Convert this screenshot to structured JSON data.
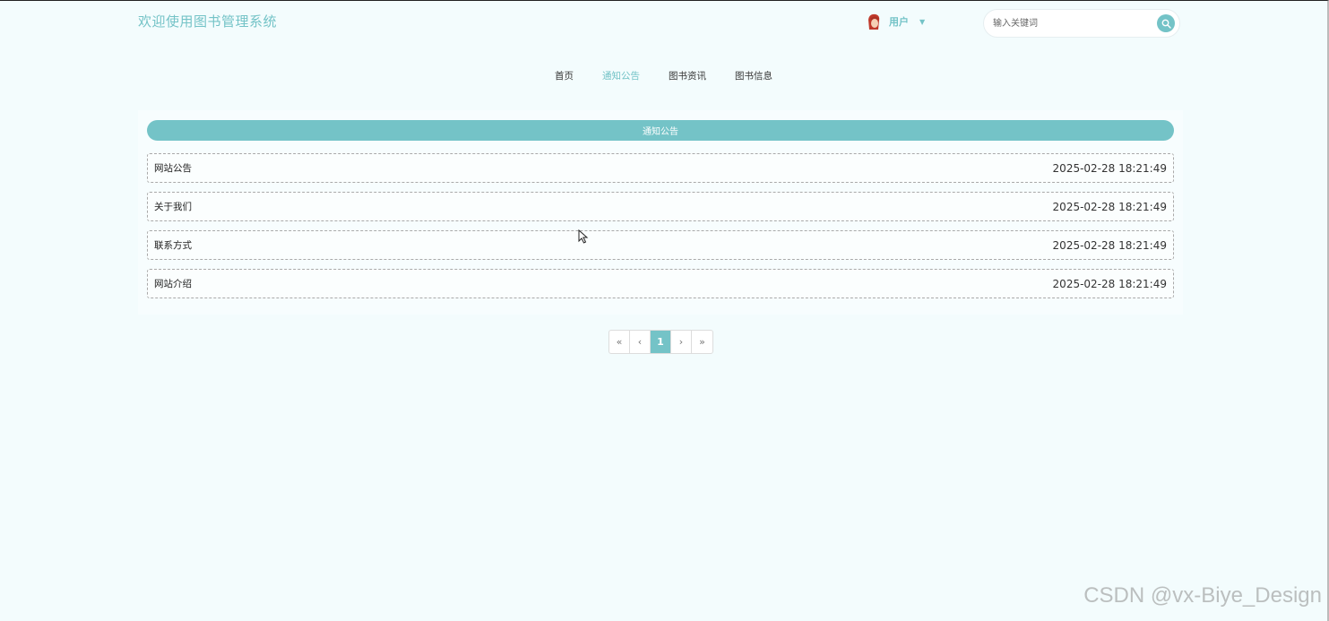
{
  "header": {
    "site_title": "欢迎使用图书管理系统",
    "user_label": "用户",
    "search_placeholder": "输入关键词"
  },
  "nav": {
    "items": [
      "首页",
      "通知公告",
      "图书资讯",
      "图书信息"
    ],
    "active": "通知公告"
  },
  "notices": {
    "header": "通知公告",
    "items": [
      {
        "title": "网站公告",
        "time": "2025-02-28 18:21:49"
      },
      {
        "title": "关于我们",
        "time": "2025-02-28 18:21:49"
      },
      {
        "title": "联系方式",
        "time": "2025-02-28 18:21:49"
      },
      {
        "title": "网站介绍",
        "time": "2025-02-28 18:21:49"
      }
    ]
  },
  "pager": {
    "first": "«",
    "prev": "‹",
    "current": "1",
    "next": "›",
    "last": "»"
  },
  "watermark": "CSDN @vx-Biye_Design",
  "colors": {
    "accent": "#74c3c7",
    "background": "#f3fcfd"
  }
}
